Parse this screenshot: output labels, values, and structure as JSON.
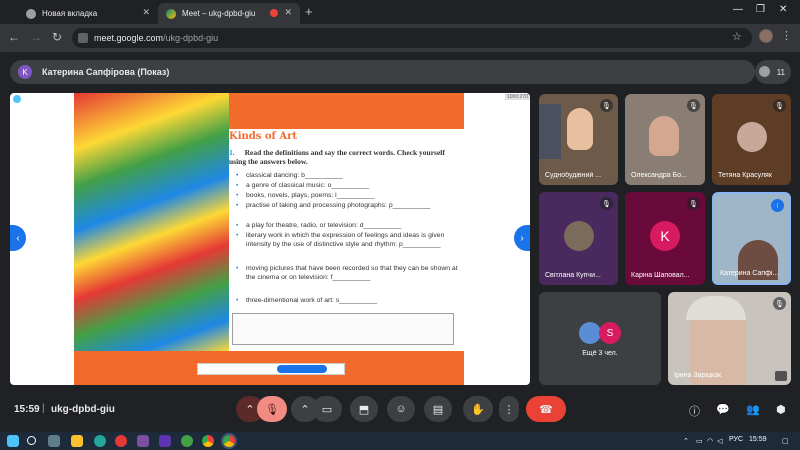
{
  "browser": {
    "tabs": [
      {
        "label": "Новая вкладка",
        "active": false
      },
      {
        "label": "Meet – ukg-dpbd-giu",
        "active": true
      }
    ],
    "new_tab_icon": "plus-icon",
    "url_host": "meet.google.com",
    "url_path": "/ukg-dpbd-giu"
  },
  "presenter": {
    "avatar_letter": "K",
    "avatar_color": "#7e57c2",
    "label": "Катерина Сапфірова (Показ)",
    "participant_count": "11"
  },
  "slide": {
    "title": "Kinds of Art",
    "task_number": "1.",
    "instruction": "Read the definitions and say the correct words. Check yourself using the answers below.",
    "items": [
      "classical dancing: b__________",
      "a genre of classical music: o__________",
      "books, novels, plays, poems: l__________",
      "practise of taking and processing photographs: p__________",
      "a play for theatre, radio, or television: d__________",
      "literary work in which the expression of feelings and ideas is given intensity by the use of distinctive style and rhythm: p__________",
      "moving pictures that have been recorded so that they can be shown at the cinema or on television: f__________",
      "three-dimentional work of art: s__________"
    ],
    "corner_label": "1000:270"
  },
  "tiles": [
    {
      "name": "Суднобудівний ...",
      "muted": true,
      "bg": "#6d5a48"
    },
    {
      "name": "Олександра Бо...",
      "muted": true,
      "bg": "#8a7e74"
    },
    {
      "name": "Тетяна Красуляк",
      "muted": true,
      "bg": "#5d3d25",
      "avatar_color": "#c8a898"
    },
    {
      "name": "Світлана Купчи...",
      "muted": true,
      "bg": "#4a2a5e",
      "avatar_color": "#7b6b5a"
    },
    {
      "name": "Каріна Шаповал...",
      "muted": true,
      "bg": "#6a0a3a",
      "avatar_letter": "K",
      "avatar_color": "#d81b60"
    },
    {
      "name": "Катерина Сапфі...",
      "muted": false,
      "bg": "#9fb6c8"
    },
    {
      "name": "Ещё 3 чел.",
      "muted": false,
      "bg": "#3c4043",
      "avatar_letter": "S",
      "avatar_color": "#d81b60"
    },
    {
      "name": "Ірина Заріцкак",
      "muted": true,
      "bg": "#c9c3bd"
    }
  ],
  "meeting": {
    "time": "15:59",
    "code": "ukg-dpbd-giu"
  },
  "taskbar": {
    "lang": "РУС",
    "time": "15:59"
  },
  "colors": {
    "accent": "#1a73e8",
    "danger": "#ea4335",
    "slide_orange": "#f26b2b"
  }
}
